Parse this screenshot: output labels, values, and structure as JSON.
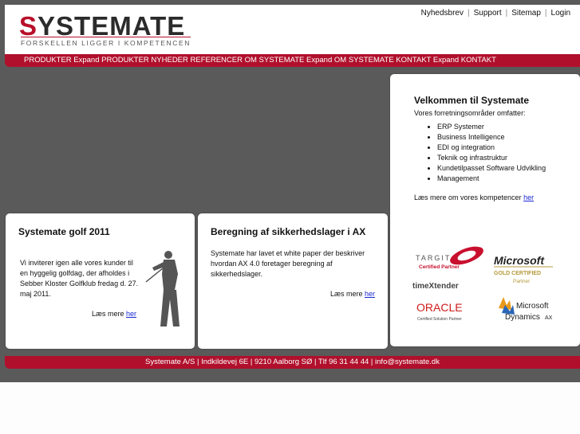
{
  "logo": {
    "first_letter": "S",
    "rest": "YSTEMATE",
    "tagline": "FORSKELLEN LIGGER I KOMPETENCEN"
  },
  "toplinks": [
    "Nyhedsbrev",
    "Support",
    "Sitemap",
    "Login"
  ],
  "nav": {
    "text": "PRODUKTER Expand PRODUKTER NYHEDER REFERENCER OM SYSTEMATE Expand OM SYSTEMATE KONTAKT Expand KONTAKT"
  },
  "welcome": {
    "title": "Velkommen til Systemate",
    "intro": "Vores forretningsområder omfatter:",
    "items": [
      "ERP Systemer",
      "Business Intelligence",
      "EDI og integration",
      "Teknik og infrastruktur",
      "Kundetilpasset Software Udvikling",
      "Management"
    ],
    "more_prefix": "Læs mere om vores kompetencer ",
    "more_link": "her"
  },
  "golf": {
    "title": "Systemate golf 2011",
    "body": "Vi inviterer igen alle vores kunder til en hyggelig golfdag, der afholdes i Sebber Kloster Golfklub fredag d. 27. maj 2011.",
    "more_prefix": "Læs mere ",
    "more_link": "her"
  },
  "calc": {
    "title": "Beregning af sikkerhedslager i AX",
    "body": "Systemate har lavet et white paper der beskriver hvordan AX 4.0 foretager beregning af sikkerhedslager.",
    "more_prefix": "Læs mere ",
    "more_link": "her"
  },
  "partners": {
    "targit": "TARGIT",
    "targit_sub": "Certified Partner",
    "microsoft": "Microsoft",
    "ms_gold": "GOLD CERTIFIED",
    "ms_partner": "Partner",
    "timextender": "timeXtender",
    "oracle": "ORACLE",
    "oracle_sub": "Certified Solution Partner",
    "dynamics_ms": "Microsoft",
    "dynamics": "Dynamics",
    "dynamics_ax": "AX"
  },
  "footer": {
    "text": "Systemate A/S | Indkildevej 6E | 9210 Aalborg SØ | Tlf 96 31 44 44 | info@systemate.dk"
  },
  "colors": {
    "brand_red": "#b0102c",
    "link_blue": "#1a2ad4",
    "background_gray": "#5a5a5a"
  }
}
